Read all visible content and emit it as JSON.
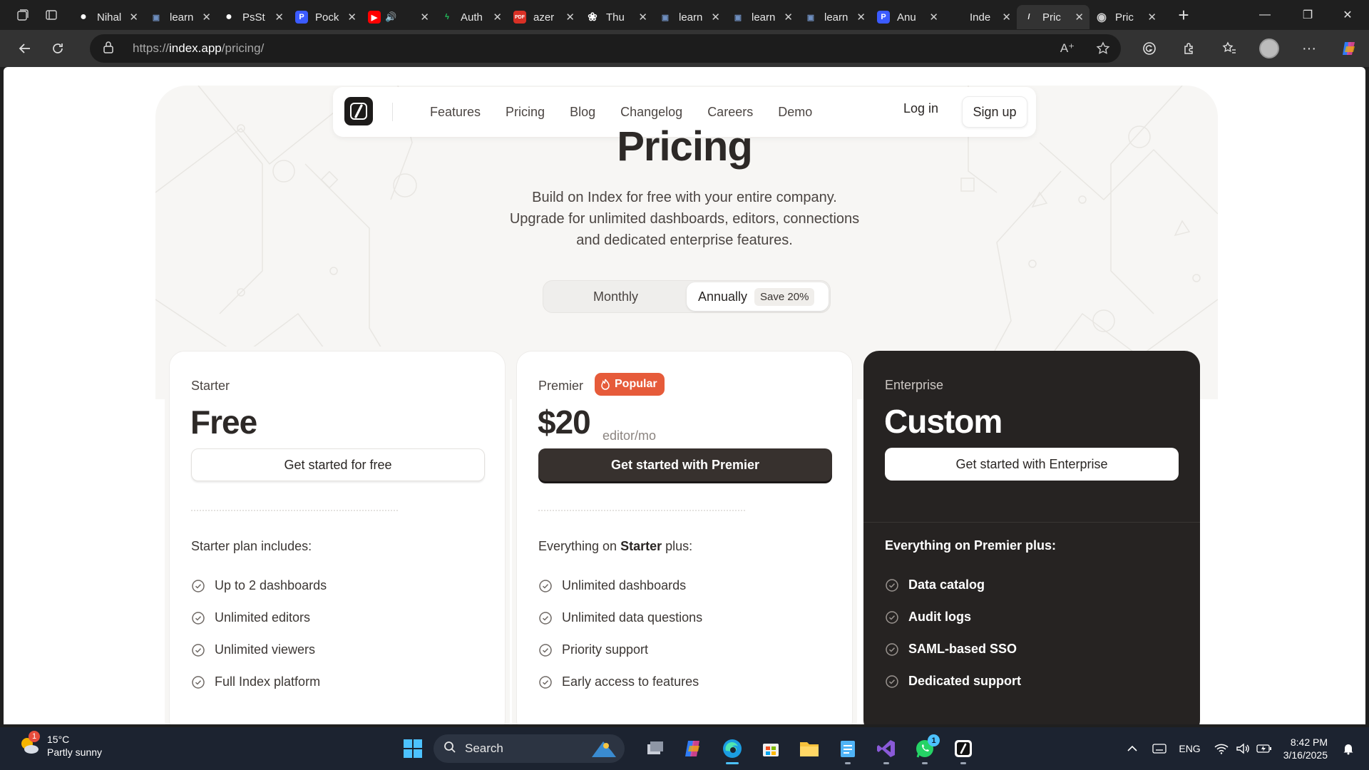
{
  "browser": {
    "tabs": [
      {
        "title": "Nihal",
        "icon": "github-icon",
        "color": "#ffffff"
      },
      {
        "title": "learn",
        "icon": "page-icon",
        "color": "#6f8fc0"
      },
      {
        "title": "PsSt",
        "icon": "github-icon",
        "color": "#ffffff"
      },
      {
        "title": "Pock",
        "icon": "p-icon",
        "color": "#3b5bff"
      },
      {
        "title": "",
        "icon": "youtube-icon",
        "color": "#ff0000"
      },
      {
        "title": "Auth",
        "icon": "bolt-icon",
        "color": "#22c55e"
      },
      {
        "title": "azer",
        "icon": "pdf-icon",
        "color": "#d93025"
      },
      {
        "title": "Thu",
        "icon": "openai-icon",
        "color": "#ffffff"
      },
      {
        "title": "learn",
        "icon": "page-icon",
        "color": "#6f8fc0"
      },
      {
        "title": "learn",
        "icon": "page-icon",
        "color": "#6f8fc0"
      },
      {
        "title": "learn",
        "icon": "page-icon",
        "color": "#6f8fc0"
      },
      {
        "title": "Anu",
        "icon": "p-icon",
        "color": "#3b5bff"
      },
      {
        "title": "Inde",
        "icon": "blank-icon",
        "color": "#1f1f1f"
      },
      {
        "title": "Pric",
        "icon": "index-icon",
        "color": "#ffffff"
      },
      {
        "title": "Pric",
        "icon": "globe-icon",
        "color": "#cccccc"
      }
    ],
    "url_prefix": "https://",
    "url_domain": "index.app",
    "url_path": "/pricing/"
  },
  "nav": {
    "links": [
      "Features",
      "Pricing",
      "Blog",
      "Changelog",
      "Careers",
      "Demo"
    ],
    "login": "Log in",
    "signup": "Sign up"
  },
  "hero": {
    "title": "Pricing",
    "subtitle_lines": [
      "Build on Index for free with your entire company.",
      "Upgrade for unlimited dashboards, editors, connections",
      "and dedicated enterprise features."
    ],
    "toggle_monthly": "Monthly",
    "toggle_annually": "Annually",
    "save_badge": "Save 20%",
    "selected": "Annually"
  },
  "plans": [
    {
      "tier": "Starter",
      "price": "Free",
      "cta": "Get started for free",
      "includes_text": "Starter plan includes:",
      "features": [
        "Up to 2 dashboards",
        "Unlimited editors",
        "Unlimited viewers",
        "Full Index platform"
      ]
    },
    {
      "tier": "Premier",
      "badge": "Popular",
      "price": "$20",
      "unit": "editor/mo",
      "cta": "Get started with Premier",
      "includes_prefix": "Everything on ",
      "includes_bold": "Starter",
      "includes_suffix": " plus:",
      "features": [
        "Unlimited dashboards",
        "Unlimited data questions",
        "Priority support",
        "Early access to features"
      ]
    },
    {
      "tier": "Enterprise",
      "price": "Custom",
      "cta": "Get started with Enterprise",
      "includes_text": "Everything on Premier plus:",
      "features": [
        "Data catalog",
        "Audit logs",
        "SAML-based SSO",
        "Dedicated support"
      ]
    }
  ],
  "taskbar": {
    "weather_temp": "15°C",
    "weather_desc": "Partly sunny",
    "weather_badge": "1",
    "search_label": "Search",
    "whatsapp_badge": "1",
    "language": "ENG",
    "time": "8:42 PM",
    "date": "3/16/2025"
  },
  "colors": {
    "accent_popular": "#e65b3a",
    "dark_card": "#262322",
    "hero_bg": "#f7f6f4"
  }
}
